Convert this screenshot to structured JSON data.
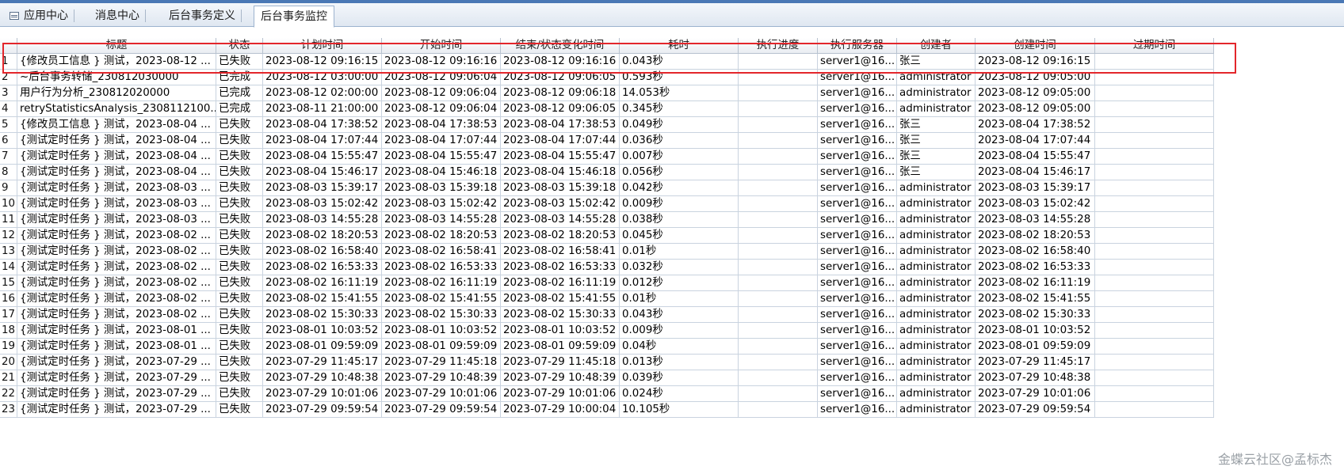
{
  "tabs": [
    {
      "label": "应用中心",
      "active": false
    },
    {
      "label": "消息中心",
      "active": false
    },
    {
      "label": "后台事务定义",
      "active": false
    },
    {
      "label": "后台事务监控",
      "active": true
    }
  ],
  "columns": [
    "",
    "标题",
    "状态",
    "计划时间",
    "开始时间",
    "结束/状态变化时间",
    "耗时",
    "执行进度",
    "执行服务器",
    "创建者",
    "创建时间",
    "过期时间"
  ],
  "rows": [
    [
      "1",
      "{修改员工信息 } 测试，2023-08-12 ...",
      "已失败",
      "2023-08-12 09:16:15",
      "2023-08-12 09:16:16",
      "2023-08-12 09:16:16",
      "0.043秒",
      "",
      "server1@16...",
      "张三",
      "2023-08-12 09:16:15",
      ""
    ],
    [
      "2",
      "~后台事务转储_230812030000",
      "已完成",
      "2023-08-12 03:00:00",
      "2023-08-12 09:06:04",
      "2023-08-12 09:06:05",
      "0.593秒",
      "",
      "server1@16...",
      "administrator",
      "2023-08-12 09:05:00",
      ""
    ],
    [
      "3",
      "用户行为分析_230812020000",
      "已完成",
      "2023-08-12 02:00:00",
      "2023-08-12 09:06:04",
      "2023-08-12 09:06:18",
      "14.053秒",
      "",
      "server1@16...",
      "administrator",
      "2023-08-12 09:05:00",
      ""
    ],
    [
      "4",
      "retryStatisticsAnalysis_2308112100...",
      "已完成",
      "2023-08-11 21:00:00",
      "2023-08-12 09:06:04",
      "2023-08-12 09:06:05",
      "0.345秒",
      "",
      "server1@16...",
      "administrator",
      "2023-08-12 09:05:00",
      ""
    ],
    [
      "5",
      "{修改员工信息 } 测试，2023-08-04 ...",
      "已失败",
      "2023-08-04 17:38:52",
      "2023-08-04 17:38:53",
      "2023-08-04 17:38:53",
      "0.049秒",
      "",
      "server1@16...",
      "张三",
      "2023-08-04 17:38:52",
      ""
    ],
    [
      "6",
      "{测试定时任务 } 测试，2023-08-04 ...",
      "已失败",
      "2023-08-04 17:07:44",
      "2023-08-04 17:07:44",
      "2023-08-04 17:07:44",
      "0.036秒",
      "",
      "server1@16...",
      "张三",
      "2023-08-04 17:07:44",
      ""
    ],
    [
      "7",
      "{测试定时任务 } 测试，2023-08-04 ...",
      "已失败",
      "2023-08-04 15:55:47",
      "2023-08-04 15:55:47",
      "2023-08-04 15:55:47",
      "0.007秒",
      "",
      "server1@16...",
      "张三",
      "2023-08-04 15:55:47",
      ""
    ],
    [
      "8",
      "{测试定时任务 } 测试，2023-08-04 ...",
      "已失败",
      "2023-08-04 15:46:17",
      "2023-08-04 15:46:18",
      "2023-08-04 15:46:18",
      "0.056秒",
      "",
      "server1@16...",
      "张三",
      "2023-08-04 15:46:17",
      ""
    ],
    [
      "9",
      "{测试定时任务 } 测试，2023-08-03 ...",
      "已失败",
      "2023-08-03 15:39:17",
      "2023-08-03 15:39:18",
      "2023-08-03 15:39:18",
      "0.042秒",
      "",
      "server1@16...",
      "administrator",
      "2023-08-03 15:39:17",
      ""
    ],
    [
      "10",
      "{测试定时任务 } 测试，2023-08-03 ...",
      "已失败",
      "2023-08-03 15:02:42",
      "2023-08-03 15:02:42",
      "2023-08-03 15:02:42",
      "0.009秒",
      "",
      "server1@16...",
      "administrator",
      "2023-08-03 15:02:42",
      ""
    ],
    [
      "11",
      "{测试定时任务 } 测试，2023-08-03 ...",
      "已失败",
      "2023-08-03 14:55:28",
      "2023-08-03 14:55:28",
      "2023-08-03 14:55:28",
      "0.038秒",
      "",
      "server1@16...",
      "administrator",
      "2023-08-03 14:55:28",
      ""
    ],
    [
      "12",
      "{测试定时任务 } 测试，2023-08-02 ...",
      "已失败",
      "2023-08-02 18:20:53",
      "2023-08-02 18:20:53",
      "2023-08-02 18:20:53",
      "0.045秒",
      "",
      "server1@16...",
      "administrator",
      "2023-08-02 18:20:53",
      ""
    ],
    [
      "13",
      "{测试定时任务 } 测试，2023-08-02 ...",
      "已失败",
      "2023-08-02 16:58:40",
      "2023-08-02 16:58:41",
      "2023-08-02 16:58:41",
      "0.01秒",
      "",
      "server1@16...",
      "administrator",
      "2023-08-02 16:58:40",
      ""
    ],
    [
      "14",
      "{测试定时任务 } 测试，2023-08-02 ...",
      "已失败",
      "2023-08-02 16:53:33",
      "2023-08-02 16:53:33",
      "2023-08-02 16:53:33",
      "0.032秒",
      "",
      "server1@16...",
      "administrator",
      "2023-08-02 16:53:33",
      ""
    ],
    [
      "15",
      "{测试定时任务 } 测试，2023-08-02 ...",
      "已失败",
      "2023-08-02 16:11:19",
      "2023-08-02 16:11:19",
      "2023-08-02 16:11:19",
      "0.012秒",
      "",
      "server1@16...",
      "administrator",
      "2023-08-02 16:11:19",
      ""
    ],
    [
      "16",
      "{测试定时任务 } 测试，2023-08-02 ...",
      "已失败",
      "2023-08-02 15:41:55",
      "2023-08-02 15:41:55",
      "2023-08-02 15:41:55",
      "0.01秒",
      "",
      "server1@16...",
      "administrator",
      "2023-08-02 15:41:55",
      ""
    ],
    [
      "17",
      "{测试定时任务 } 测试，2023-08-02 ...",
      "已失败",
      "2023-08-02 15:30:33",
      "2023-08-02 15:30:33",
      "2023-08-02 15:30:33",
      "0.043秒",
      "",
      "server1@16...",
      "administrator",
      "2023-08-02 15:30:33",
      ""
    ],
    [
      "18",
      "{测试定时任务 } 测试，2023-08-01 ...",
      "已失败",
      "2023-08-01 10:03:52",
      "2023-08-01 10:03:52",
      "2023-08-01 10:03:52",
      "0.009秒",
      "",
      "server1@16...",
      "administrator",
      "2023-08-01 10:03:52",
      ""
    ],
    [
      "19",
      "{测试定时任务 } 测试，2023-08-01 ...",
      "已失败",
      "2023-08-01 09:59:09",
      "2023-08-01 09:59:09",
      "2023-08-01 09:59:09",
      "0.04秒",
      "",
      "server1@16...",
      "administrator",
      "2023-08-01 09:59:09",
      ""
    ],
    [
      "20",
      "{测试定时任务 } 测试，2023-07-29 ...",
      "已失败",
      "2023-07-29 11:45:17",
      "2023-07-29 11:45:18",
      "2023-07-29 11:45:18",
      "0.013秒",
      "",
      "server1@16...",
      "administrator",
      "2023-07-29 11:45:17",
      ""
    ],
    [
      "21",
      "{测试定时任务 } 测试，2023-07-29 ...",
      "已失败",
      "2023-07-29 10:48:38",
      "2023-07-29 10:48:39",
      "2023-07-29 10:48:39",
      "0.039秒",
      "",
      "server1@16...",
      "administrator",
      "2023-07-29 10:48:38",
      ""
    ],
    [
      "22",
      "{测试定时任务 } 测试，2023-07-29 ...",
      "已失败",
      "2023-07-29 10:01:06",
      "2023-07-29 10:01:06",
      "2023-07-29 10:01:06",
      "0.024秒",
      "",
      "server1@16...",
      "administrator",
      "2023-07-29 10:01:06",
      ""
    ],
    [
      "23",
      "{测试定时任务 } 测试，2023-07-29 ...",
      "已失败",
      "2023-07-29 09:59:54",
      "2023-07-29 09:59:54",
      "2023-07-29 10:00:04",
      "10.105秒",
      "",
      "server1@16...",
      "administrator",
      "2023-07-29 09:59:54",
      ""
    ]
  ],
  "watermark": "金蝶云社区@孟标杰",
  "colors": {
    "highlight": "#e3262b",
    "tab_accent": "#4a78b5"
  }
}
